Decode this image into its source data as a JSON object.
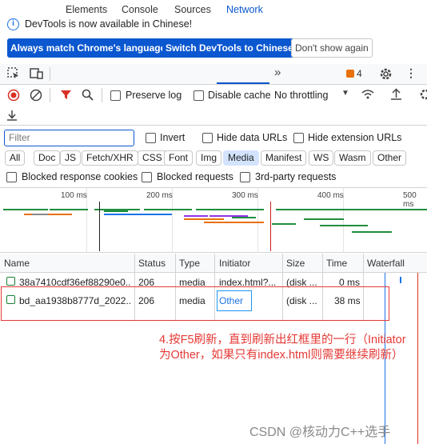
{
  "banner": {
    "message": "DevTools is now available in Chinese!",
    "btn_match": "Always match Chrome's language",
    "btn_switch": "Switch DevTools to Chinese",
    "btn_dismiss": "Don't show again"
  },
  "tabs": [
    "Elements",
    "Console",
    "Sources",
    "Network"
  ],
  "issues_count": "4",
  "network_toolbar": {
    "preserve_log": "Preserve log",
    "disable_cache": "Disable cache",
    "throttling": "No throttling"
  },
  "filter": {
    "placeholder": "Filter",
    "invert": "Invert",
    "hide_data_urls": "Hide data URLs",
    "hide_extension_urls": "Hide extension URLs"
  },
  "type_chips": [
    "All",
    "Doc",
    "JS",
    "Fetch/XHR",
    "CSS",
    "Font",
    "Img",
    "Media",
    "Manifest",
    "WS",
    "Wasm",
    "Other"
  ],
  "active_chip": "Media",
  "options": {
    "blocked_cookies": "Blocked response cookies",
    "blocked_requests": "Blocked requests",
    "third_party": "3rd-party requests"
  },
  "timeline_ticks": [
    "100 ms",
    "200 ms",
    "300 ms",
    "400 ms",
    "500 ms"
  ],
  "columns": [
    "Name",
    "Status",
    "Type",
    "Initiator",
    "Size",
    "Time",
    "Waterfall"
  ],
  "rows": [
    {
      "name": "38a7410cdf36ef88290e0...",
      "status": "206",
      "type": "media",
      "initiator": "index.html?...",
      "size": "(disk ...",
      "time": "0 ms"
    },
    {
      "name": "bd_aa1938b8777d_2022...",
      "status": "206",
      "type": "media",
      "initiator": "Other",
      "size": "(disk ...",
      "time": "38 ms"
    }
  ],
  "annotation": {
    "line1": "4.按F5刷新，直到刷新出红框里的一行（Initiator",
    "line2": "为Other，如果只有index.html则需要继续刷新）"
  },
  "watermark": "CSDN @核动力C++选手",
  "colors": {
    "accent": "#0b57d0",
    "annotation": "#e53935",
    "initiator_box": "#2196f3"
  }
}
